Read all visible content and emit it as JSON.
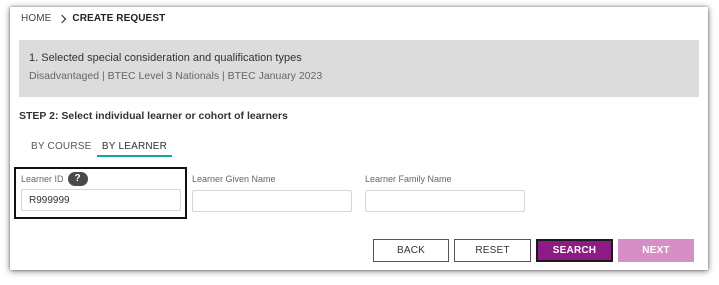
{
  "breadcrumb": {
    "home": "HOME",
    "current": "CREATE REQUEST"
  },
  "summary": {
    "title": "1. Selected special consideration and qualification types",
    "detail": "Disadvantaged | BTEC Level 3 Nationals | BTEC January 2023"
  },
  "step": {
    "heading": "STEP 2: Select individual learner or cohort of learners"
  },
  "tabs": [
    {
      "label": "BY COURSE",
      "active": false
    },
    {
      "label": "BY LEARNER",
      "active": true
    }
  ],
  "fields": {
    "learner_id": {
      "label": "Learner ID",
      "help": "?",
      "value": "R999999"
    },
    "given_name": {
      "label": "Learner Given Name",
      "value": ""
    },
    "family_name": {
      "label": "Learner Family Name",
      "value": ""
    }
  },
  "buttons": {
    "back": "BACK",
    "reset": "RESET",
    "search": "SEARCH",
    "next": "NEXT"
  },
  "colors": {
    "summary_bg": "#dcdcdc",
    "active_tab_underline": "#12a8a8",
    "search_bg": "#8e1a86",
    "next_bg_disabled": "#d68fc6"
  },
  "icons": {
    "breadcrumb_separator": "chevron-right-icon",
    "learner_id_help": "question-mark-icon"
  }
}
